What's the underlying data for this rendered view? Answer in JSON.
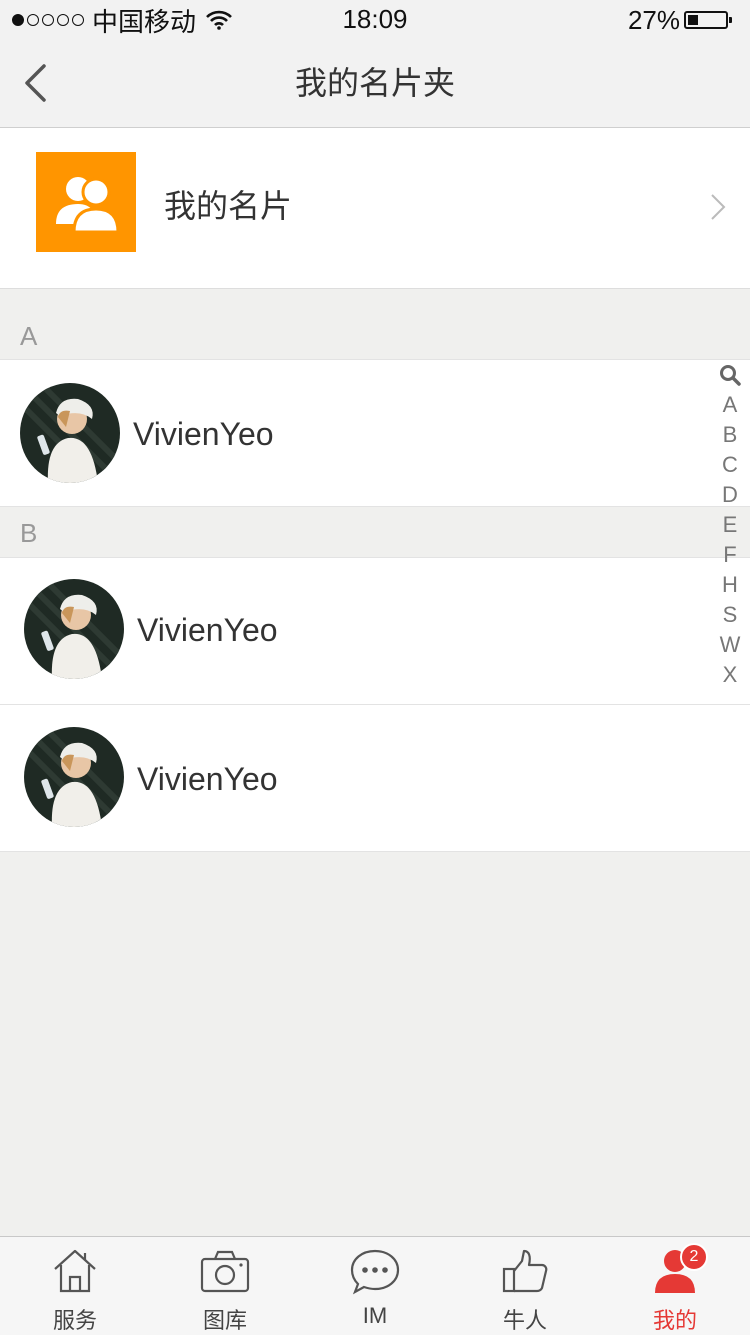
{
  "status_bar": {
    "carrier": "中国移动",
    "time": "18:09",
    "battery": "27%"
  },
  "nav": {
    "title": "我的名片夹"
  },
  "my_card": {
    "label": "我的名片"
  },
  "sections": [
    {
      "letter": "A",
      "contacts": [
        {
          "name": "VivienYeo"
        }
      ]
    },
    {
      "letter": "B",
      "contacts": [
        {
          "name": "VivienYeo"
        },
        {
          "name": "VivienYeo"
        }
      ]
    }
  ],
  "index_bar": {
    "search_icon": "search-icon",
    "letters": [
      "A",
      "B",
      "C",
      "D",
      "E",
      "F",
      "H",
      "S",
      "W",
      "X"
    ]
  },
  "tab_bar": {
    "tabs": [
      {
        "label": "服务",
        "icon": "home-icon"
      },
      {
        "label": "图库",
        "icon": "camera-icon"
      },
      {
        "label": "IM",
        "icon": "chat-bubble-icon"
      },
      {
        "label": "牛人",
        "icon": "thumbs-up-icon"
      },
      {
        "label": "我的",
        "icon": "user-icon",
        "badge": "2",
        "active": true
      }
    ]
  },
  "colors": {
    "accent": "#e53935",
    "card_icon_bg": "#ff9500",
    "background": "#f0f0ee"
  }
}
